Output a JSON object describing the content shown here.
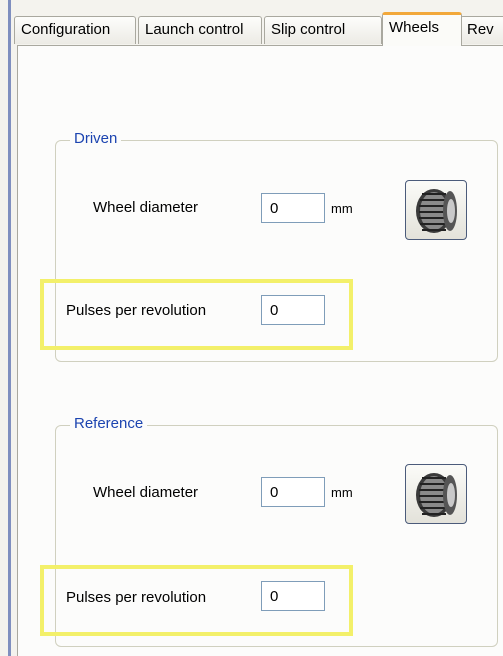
{
  "tabs": [
    {
      "label": "Configuration",
      "active": false
    },
    {
      "label": "Launch control",
      "active": false
    },
    {
      "label": "Slip control",
      "active": false
    },
    {
      "label": "Wheels",
      "active": true
    },
    {
      "label": "Rev",
      "active": false
    }
  ],
  "groups": {
    "driven": {
      "title": "Driven",
      "wheel_diameter_label": "Wheel diameter",
      "wheel_diameter_value": "0",
      "wheel_diameter_unit": "mm",
      "pulses_label": "Pulses per revolution",
      "pulses_value": "0",
      "icon": "tire-icon"
    },
    "reference": {
      "title": "Reference",
      "wheel_diameter_label": "Wheel diameter",
      "wheel_diameter_value": "0",
      "wheel_diameter_unit": "mm",
      "pulses_label": "Pulses per revolution",
      "pulses_value": "0",
      "icon": "tire-icon"
    }
  },
  "colors": {
    "active_tab_accent": "#f2a83a",
    "group_title": "#1c44b0",
    "highlight": "#f3f06a"
  }
}
